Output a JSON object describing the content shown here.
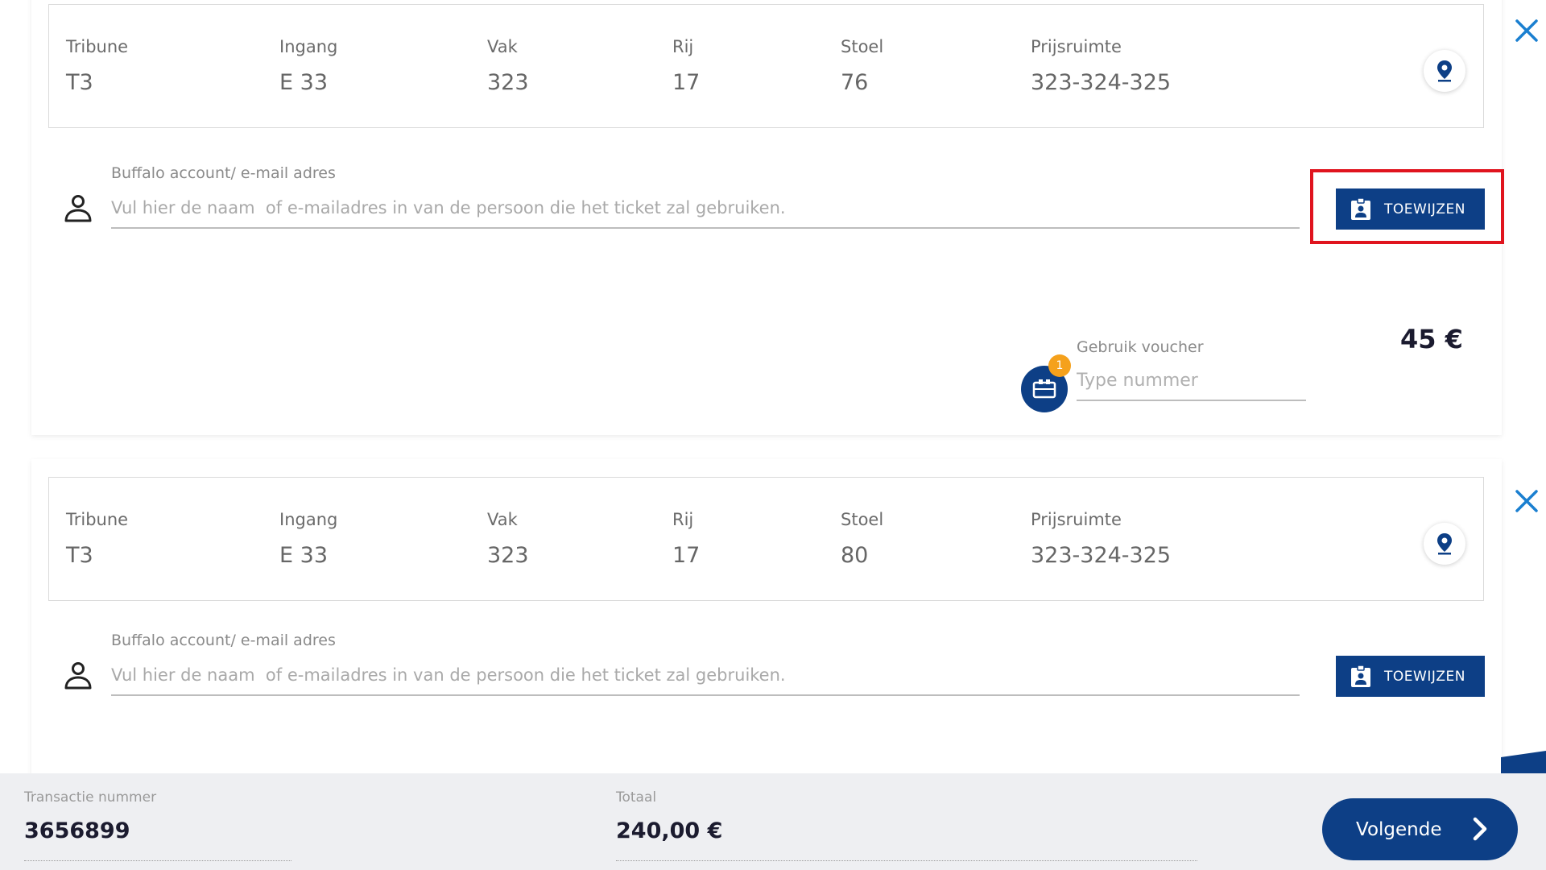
{
  "tickets": [
    {
      "tribune_label": "Tribune",
      "tribune": "T3",
      "ingang_label": "Ingang",
      "ingang": "E 33",
      "vak_label": "Vak",
      "vak": "323",
      "rij_label": "Rij",
      "rij": "17",
      "stoel_label": "Stoel",
      "stoel": "76",
      "prijs_label": "Prijsruimte",
      "prijs": "323-324-325",
      "account_label": "Buffalo account/ e-mail adres",
      "account_placeholder": "Vul hier de naam  of e-mailadres in van de persoon die het ticket zal gebruiken.",
      "account_value": "",
      "assign_label": "TOEWIJZEN",
      "voucher_label": "Gebruik voucher",
      "voucher_placeholder": "Type nummer",
      "voucher_badge": "1",
      "price": "45 €"
    },
    {
      "tribune_label": "Tribune",
      "tribune": "T3",
      "ingang_label": "Ingang",
      "ingang": "E 33",
      "vak_label": "Vak",
      "vak": "323",
      "rij_label": "Rij",
      "rij": "17",
      "stoel_label": "Stoel",
      "stoel": "80",
      "prijs_label": "Prijsruimte",
      "prijs": "323-324-325",
      "account_label": "Buffalo account/ e-mail adres",
      "account_placeholder": "Vul hier de naam  of e-mailadres in van de persoon die het ticket zal gebruiken.",
      "account_value": "",
      "assign_label": "TOEWIJZEN"
    }
  ],
  "footer": {
    "transaction_label": "Transactie nummer",
    "transaction_value": "3656899",
    "total_label": "Totaal",
    "total_value": "240,00 €",
    "next_label": "Volgende"
  },
  "icons": {
    "close": "close-icon",
    "map": "map-pin-icon",
    "user": "user-icon",
    "assign": "badge-icon",
    "voucher": "voucher-icon",
    "next": "chevron-right-icon"
  },
  "colors": {
    "primary": "#0d3f86",
    "highlight": "#e0141e",
    "badge": "#f5a11c",
    "close": "#1a7fd0"
  }
}
